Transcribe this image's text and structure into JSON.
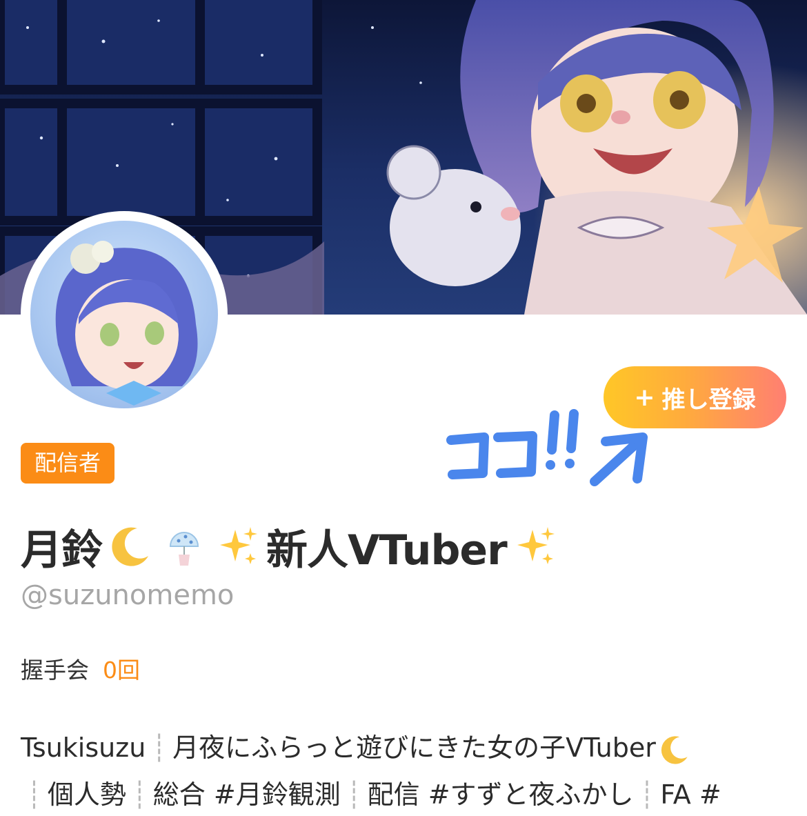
{
  "profile": {
    "badge": "配信者",
    "name_part1": "月鈴",
    "name_part2": "新人VTuber",
    "handle": "@suzunomemo",
    "follow_button": "推し登録",
    "follow_plus": "+",
    "stats": {
      "label": "握手会",
      "value": "0回"
    },
    "bio": {
      "line1_a": "Tsukisuzu",
      "line1_b": "月夜にふらっと遊びにきた女の子VTuber",
      "line2_a": "個人勢",
      "line2_b": "総合 #月鈴観測",
      "line2_c": "配信 #すずと夜ふかし",
      "line2_d": "FA #"
    }
  },
  "annotation": {
    "text": "ココ!!"
  },
  "colors": {
    "accent_orange": "#fb8c16",
    "button_gradient_start": "#ffc727",
    "button_gradient_end": "#ff7f72",
    "annotation_blue": "#4a86ec",
    "handle_gray": "#a6a6a6"
  },
  "icons": [
    "moon-icon",
    "wind-chime-icon",
    "sparkles-icon",
    "arrow-icon"
  ]
}
